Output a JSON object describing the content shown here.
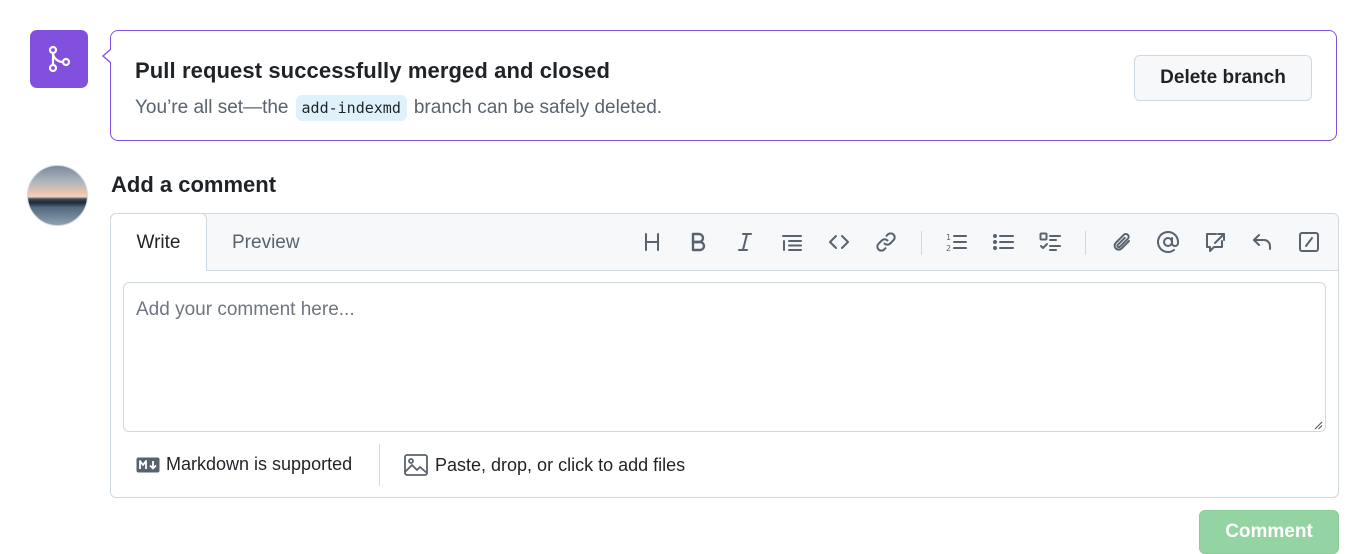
{
  "merge_banner": {
    "title": "Pull request successfully merged and closed",
    "sub_prefix": "You’re all set—the",
    "branch_name": "add-indexmd",
    "sub_suffix": "branch can be safely deleted.",
    "delete_label": "Delete branch",
    "icon": "git-merge-icon",
    "accent": "#8250df"
  },
  "comment": {
    "heading": "Add a comment",
    "tabs": {
      "write": "Write",
      "preview": "Preview"
    },
    "placeholder": "Add your comment here...",
    "toolbar_icons": [
      "heading-icon",
      "bold-icon",
      "italic-icon",
      "quote-icon",
      "code-icon",
      "link-icon",
      "ordered-list-icon",
      "unordered-list-icon",
      "task-list-icon",
      "attach-icon",
      "mention-icon",
      "reference-icon",
      "reply-icon",
      "slash-command-icon"
    ],
    "markdown_note": "Markdown is supported",
    "files_note": "Paste, drop, or click to add files",
    "submit_label": "Comment",
    "submit_color": "#94d3a2"
  }
}
